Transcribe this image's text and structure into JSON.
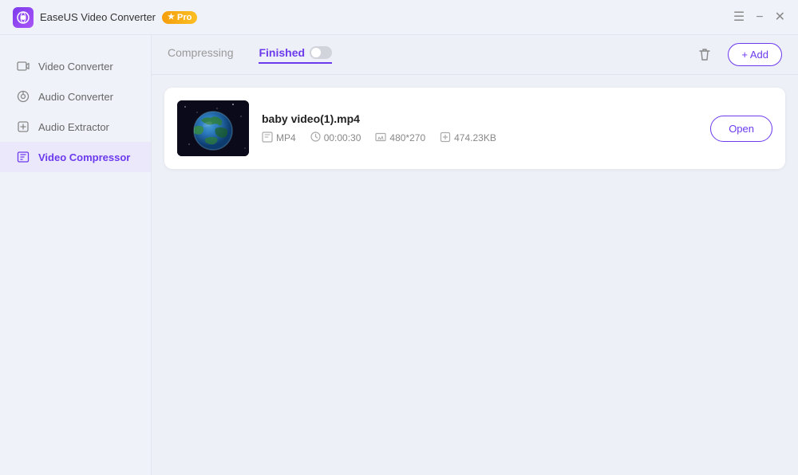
{
  "app": {
    "icon": "▶",
    "title": "EaseUS Video Converter",
    "pro_label": "Pro",
    "pro_star": "★"
  },
  "title_controls": {
    "menu_icon": "☰",
    "minimize_icon": "−",
    "close_icon": "✕"
  },
  "sidebar": {
    "items": [
      {
        "id": "video-converter",
        "label": "Video Converter",
        "icon": "◎",
        "active": false
      },
      {
        "id": "audio-converter",
        "label": "Audio Converter",
        "icon": "♫",
        "active": false
      },
      {
        "id": "audio-extractor",
        "label": "Audio Extractor",
        "icon": "⬡",
        "active": false
      },
      {
        "id": "video-compressor",
        "label": "Video Compressor",
        "icon": "⬜",
        "active": true
      }
    ]
  },
  "tabs": {
    "compressing_label": "Compressing",
    "finished_label": "Finished",
    "active": "finished"
  },
  "toolbar": {
    "trash_icon": "🗑",
    "add_label": "+ Add"
  },
  "file": {
    "name": "baby video(1).mp4",
    "format": "MP4",
    "duration": "00:00:30",
    "resolution": "480*270",
    "size": "474.23KB",
    "open_label": "Open"
  }
}
